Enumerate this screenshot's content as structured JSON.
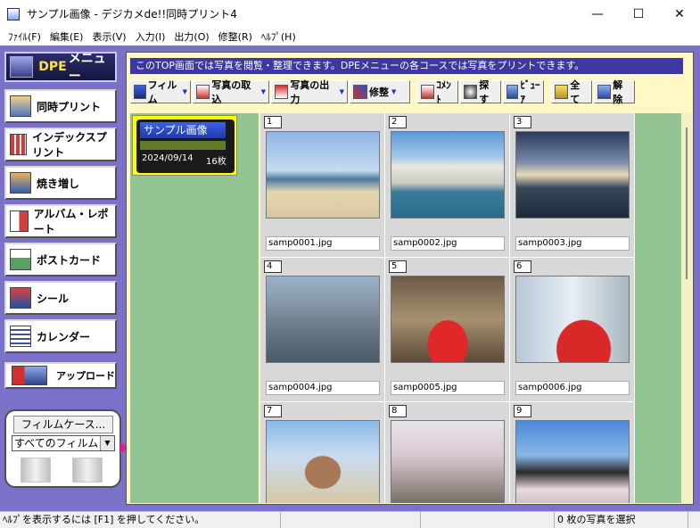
{
  "window": {
    "title": "サンプル画像 - デジカメde!!同時プリント4",
    "minimize": "—",
    "maximize": "☐",
    "close": "✕"
  },
  "menubar": [
    {
      "label": "ﾌｧｲﾙ(F)"
    },
    {
      "label": "編集(E)"
    },
    {
      "label": "表示(V)"
    },
    {
      "label": "入力(I)"
    },
    {
      "label": "出力(O)"
    },
    {
      "label": "修整(R)"
    },
    {
      "label": "ﾍﾙﾌﾟ(H)"
    }
  ],
  "sidebar": {
    "header_prefix": "DPE",
    "header_suffix": "メニュー",
    "items": [
      {
        "label": "同時プリント",
        "icon": "photo-print-icon"
      },
      {
        "label": "インデックスプリント",
        "icon": "index-grid-icon"
      },
      {
        "label": "焼き増し",
        "icon": "reprint-icon"
      },
      {
        "label": "アルバム・レポート",
        "icon": "album-icon"
      },
      {
        "label": "ポストカード",
        "icon": "postcard-icon"
      },
      {
        "label": "シール",
        "icon": "sticker-icon"
      },
      {
        "label": "カレンダー",
        "icon": "calendar-icon"
      }
    ],
    "upload": "アップロード",
    "filmcase_button": "フィルムケース...",
    "filmcase_select": "すべてのフィルム"
  },
  "info_bar": "このTOP画面では写真を閲覧・整理できます。DPEメニューの各コースでは写真をプリントできます。",
  "toolbar": {
    "film": "フィルム",
    "import": "写真の取込",
    "export": "写真の出力",
    "retouch": "修整",
    "comment": "ｺﾒﾝﾄ",
    "search": "探す",
    "viewer": "ﾋﾞｭｰｱ",
    "select_all": "全て",
    "deselect": "解除"
  },
  "film": {
    "name": "サンプル画像",
    "date": "2024/09/14",
    "count": "16枚"
  },
  "thumbnails": [
    {
      "num": "1",
      "file": "samp0001.jpg"
    },
    {
      "num": "2",
      "file": "samp0002.jpg"
    },
    {
      "num": "3",
      "file": "samp0003.jpg"
    },
    {
      "num": "4",
      "file": "samp0004.jpg"
    },
    {
      "num": "5",
      "file": "samp0005.jpg"
    },
    {
      "num": "6",
      "file": "samp0006.jpg"
    },
    {
      "num": "7",
      "file": ""
    },
    {
      "num": "8",
      "file": ""
    },
    {
      "num": "9",
      "file": ""
    }
  ],
  "status": {
    "help": "ﾍﾙﾌﾟを表示するには [F1] を押してください。",
    "selection": "0 枚の写真を選択"
  },
  "colors": {
    "frame": "#7a72c8",
    "info_bar": "#3c38a0",
    "film_panel": "#92c494",
    "content_bg": "#fff8c4"
  }
}
